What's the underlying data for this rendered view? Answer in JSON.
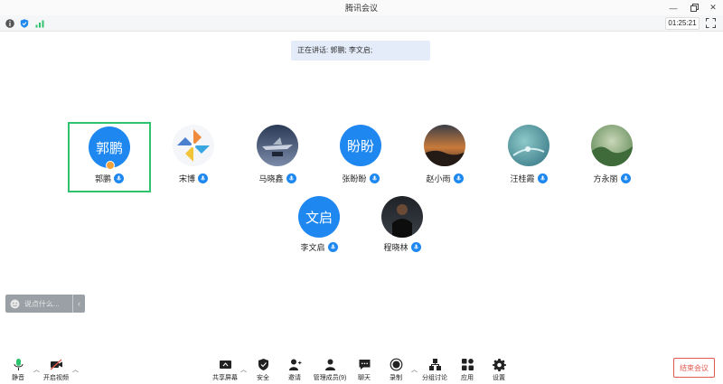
{
  "window": {
    "title": "腾讯会议",
    "controls": [
      "minimize-icon",
      "restore-icon",
      "close-icon"
    ]
  },
  "infobar": {
    "icons": [
      "info-icon",
      "shield-icon",
      "signal-icon"
    ],
    "timer": "01:25:21"
  },
  "speaking": {
    "text": "正在讲话: 郭鹏; 李文启;"
  },
  "participants": [
    {
      "name": "郭鹏",
      "avatar_text": "郭鹏",
      "avatar": "text",
      "active": true,
      "host": true
    },
    {
      "name": "宋博",
      "avatar": "pinwheel-image"
    },
    {
      "name": "马晓鑫",
      "avatar": "jet-image"
    },
    {
      "name": "张盼盼",
      "avatar_text": "盼盼",
      "avatar": "text"
    },
    {
      "name": "赵小雨",
      "avatar": "sunset-image"
    },
    {
      "name": "汪桂霞",
      "avatar": "water-drop-image"
    },
    {
      "name": "方永丽",
      "avatar": "forest-image"
    },
    {
      "name": "李文启",
      "avatar_text": "文启",
      "avatar": "text"
    },
    {
      "name": "程晓林",
      "avatar": "basketball-player-image"
    }
  ],
  "chat": {
    "placeholder": "说点什么...",
    "collapse": "‹"
  },
  "toolbar": {
    "mute": "静音",
    "video": "开启视频",
    "share": "共享屏幕",
    "security": "安全",
    "invite": "邀请",
    "members": "管理成员(9)",
    "chat": "聊天",
    "record": "录制",
    "breakout": "分组讨论",
    "apps": "应用",
    "settings": "设置",
    "end": "结束会议"
  },
  "colors": {
    "accent": "#1e88f0",
    "active_border": "#2ec36d",
    "end_red": "#e05a4f"
  }
}
